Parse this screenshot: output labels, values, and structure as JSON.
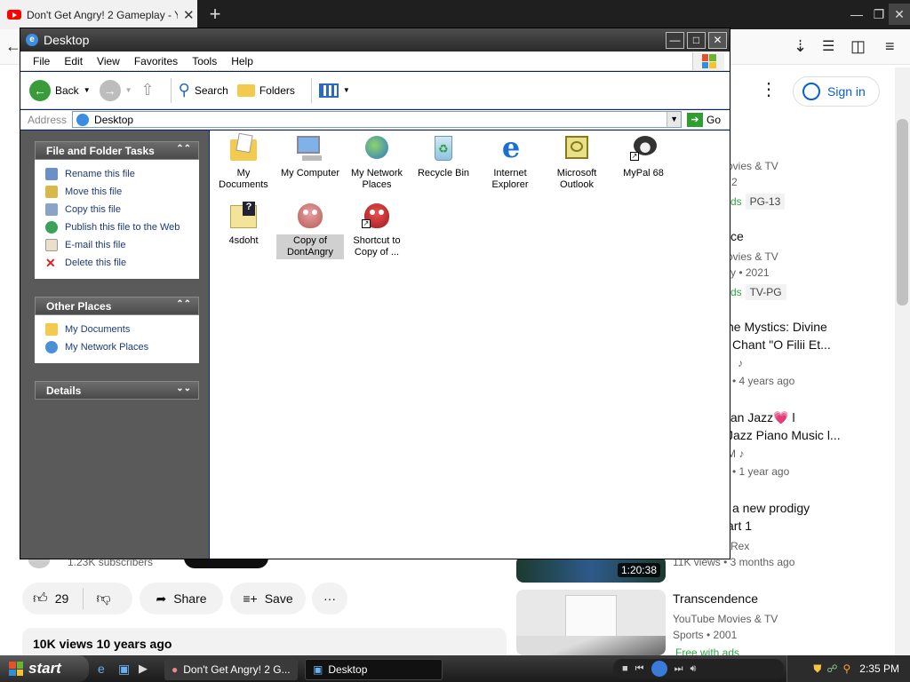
{
  "browser": {
    "tab_title": "Don't Get Angry! 2 Gameplay - Yo",
    "tab_close": "✕",
    "new_tab": "+"
  },
  "youtube": {
    "sign_in": "Sign in",
    "kebab": "⋮",
    "channel_subscribers": "1.23K subscribers",
    "likes": "29",
    "share": "Share",
    "save": "Save",
    "more": "···",
    "views_line": "10K views  10 years ago",
    "recs": [
      {
        "line1": "ovies & TV",
        "line2": "2",
        "tag1": "ds",
        "tag2": "PG-13"
      },
      {
        "title": "ce",
        "line1": "ovies & TV",
        "line2": "ry • 2021",
        "tag1": "ds",
        "tag2": "TV-PG"
      },
      {
        "title1": "he Mystics: Divine",
        "title2": "Chant \"O Filii Et...",
        "line1": "♪",
        "line2": "• 4 years ago"
      },
      {
        "title1": "tan Jazz💗 l",
        "title2": "Jazz Piano Music l...",
        "line1": "M ♪",
        "line2": "• 1 year ago"
      },
      {
        "title1": "a new prodigy",
        "title2": "art 1",
        "line1": "Rex",
        "line2": "11K views  • 3 months ago",
        "duration": "1:20:38"
      },
      {
        "title1": "Transcendence",
        "line1": "YouTube Movies & TV",
        "line2": "Sports • 2001",
        "tag1": "Free with ads"
      }
    ]
  },
  "explorer": {
    "title": "Desktop",
    "menu": [
      "File",
      "Edit",
      "View",
      "Favorites",
      "Tools",
      "Help"
    ],
    "toolbar": {
      "back": "Back",
      "search": "Search",
      "folders": "Folders"
    },
    "address_label": "Address",
    "address_value": "Desktop",
    "go": "Go",
    "panels": {
      "file_tasks": {
        "title": "File and Folder Tasks",
        "items": [
          "Rename this file",
          "Move this file",
          "Copy this file",
          "Publish this file to the Web",
          "E-mail this file",
          "Delete this file"
        ]
      },
      "other_places": {
        "title": "Other Places",
        "items": [
          "My Documents",
          "My Network Places"
        ]
      },
      "details": {
        "title": "Details"
      }
    },
    "icons": [
      {
        "label": "My Documents",
        "icon": "folder-documents-icon"
      },
      {
        "label": "My Computer",
        "icon": "computer-icon"
      },
      {
        "label": "My Network Places",
        "icon": "network-icon"
      },
      {
        "label": "Recycle Bin",
        "icon": "recycle-bin-icon"
      },
      {
        "label": "Internet Explorer",
        "icon": "ie-icon"
      },
      {
        "label": "Microsoft Outlook",
        "icon": "outlook-icon"
      },
      {
        "label": "MyPal 68",
        "icon": "mypal-icon"
      },
      {
        "label": "4sdoht",
        "icon": "folder-icon"
      },
      {
        "label": "Copy of DontAngry",
        "icon": "game-icon",
        "selected": true
      },
      {
        "label": "Shortcut to Copy of ...",
        "icon": "game-shortcut-icon"
      }
    ]
  },
  "taskbar": {
    "start": "start",
    "tasks": [
      "Don't Get Angry! 2 G...",
      "Desktop"
    ],
    "clock": "2:35 PM"
  },
  "colors": {
    "title_bar": "#3a3a3a",
    "side_pane": "#5a5a5a",
    "link_blue": "#1c3a78",
    "yt_blue": "#065fd4"
  }
}
